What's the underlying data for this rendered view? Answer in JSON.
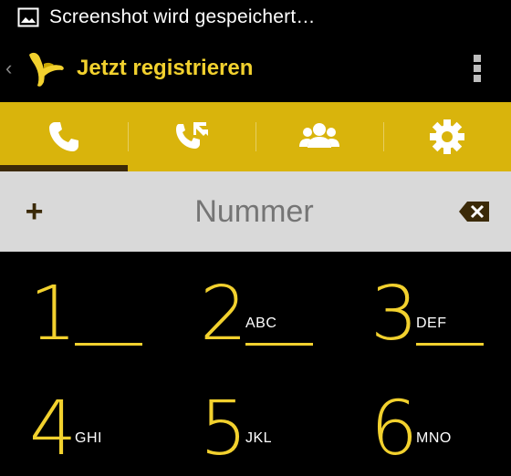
{
  "status_bar": {
    "notification_text": "Screenshot wird gespeichert…",
    "icon": "image-icon"
  },
  "action_bar": {
    "title": "Jetzt registrieren",
    "logo": "banana-logo",
    "overflow_icon": "overflow-menu-icon"
  },
  "tabs": [
    {
      "icon": "phone-icon",
      "active": true
    },
    {
      "icon": "call-log-icon",
      "active": false
    },
    {
      "icon": "contacts-icon",
      "active": false
    },
    {
      "icon": "settings-gear-icon",
      "active": false
    }
  ],
  "number_field": {
    "placeholder": "Nummer",
    "plus_label": "+",
    "backspace_icon": "backspace-icon"
  },
  "keypad": [
    {
      "digit": "1",
      "letters": ""
    },
    {
      "digit": "2",
      "letters": "ABC"
    },
    {
      "digit": "3",
      "letters": "DEF"
    },
    {
      "digit": "4",
      "letters": "GHI"
    },
    {
      "digit": "5",
      "letters": "JKL"
    },
    {
      "digit": "6",
      "letters": "MNO"
    }
  ],
  "colors": {
    "accent_yellow": "#f2d12e",
    "tab_yellow": "#d9b40c",
    "indicator_brown": "#3b2a08",
    "number_bar": "#d9d9d9"
  }
}
